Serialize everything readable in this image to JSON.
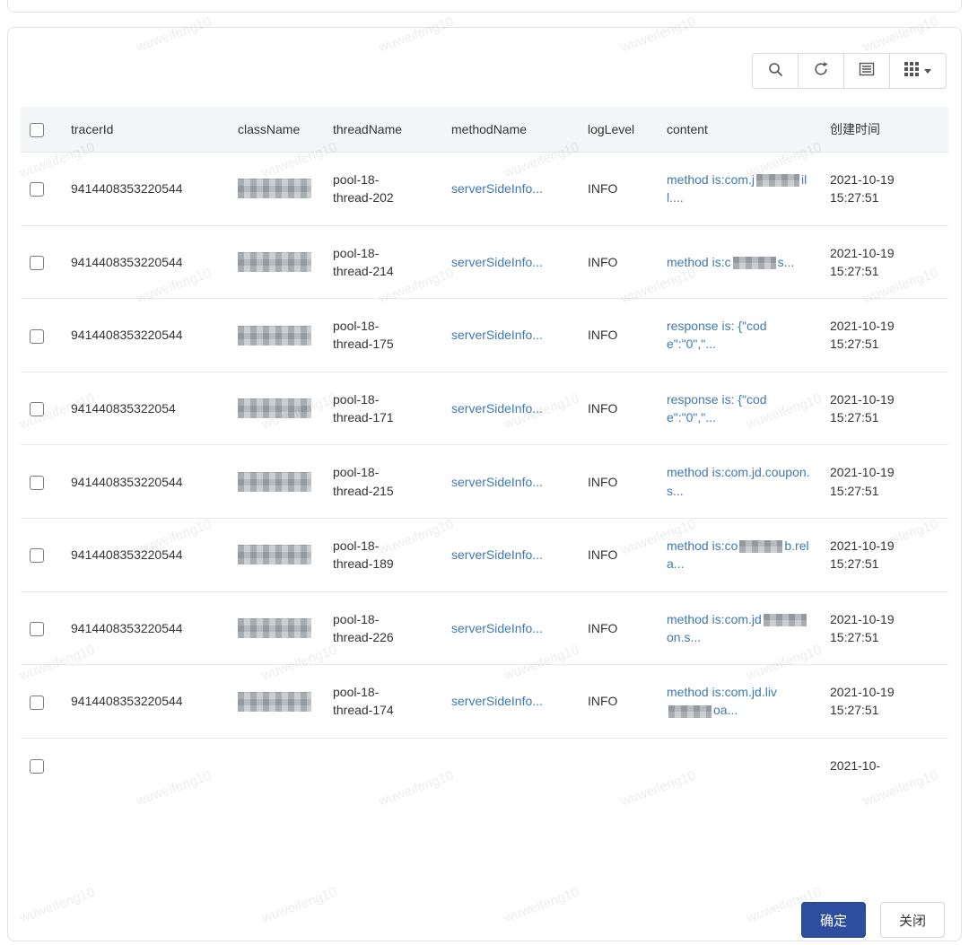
{
  "watermark": {
    "text": "wuweifeng10"
  },
  "toolbar": {
    "buttons": {
      "search": "search",
      "refresh": "refresh",
      "toggle_view": "toggle-view",
      "columns": "columns"
    }
  },
  "table": {
    "headers": {
      "tracerId": "tracerId",
      "className": "className",
      "threadName": "threadName",
      "methodName": "methodName",
      "logLevel": "logLevel",
      "content": "content",
      "time": "创建时间"
    },
    "rows": [
      {
        "tracerId": "9414408353220544",
        "className_redacted": true,
        "threadName": "pool-18-thread-202",
        "methodName": "serverSideInfo...",
        "logLevel": "INFO",
        "content": "method is:com.j[[blur]]ill....",
        "time": "2021-10-19 15:27:51"
      },
      {
        "tracerId": "9414408353220544",
        "className_redacted": true,
        "threadName": "pool-18-thread-214",
        "methodName": "serverSideInfo...",
        "logLevel": "INFO",
        "content": "method is:c[[blur]]s...",
        "time": "2021-10-19 15:27:51"
      },
      {
        "tracerId": "9414408353220544",
        "className_redacted": true,
        "threadName": "pool-18-thread-175",
        "methodName": "serverSideInfo...",
        "logLevel": "INFO",
        "content": "response is: {\"code\":\"0\",\"...",
        "time": "2021-10-19 15:27:51"
      },
      {
        "tracerId": "941440835322054",
        "className_redacted": true,
        "threadName": "pool-18-thread-171",
        "methodName": "serverSideInfo...",
        "logLevel": "INFO",
        "content": "response is: {\"code\":\"0\",\"...",
        "time": "2021-10-19 15:27:51"
      },
      {
        "tracerId": "9414408353220544",
        "className_redacted": true,
        "threadName": "pool-18-thread-215",
        "methodName": "serverSideInfo...",
        "logLevel": "INFO",
        "content": "method is:com.jd.coupon.s...",
        "time": "2021-10-19 15:27:51"
      },
      {
        "tracerId": "9414408353220544",
        "className_redacted": true,
        "threadName": "pool-18-thread-189",
        "methodName": "serverSideInfo...",
        "logLevel": "INFO",
        "content": "method is:co[[blur]]b.rela...",
        "time": "2021-10-19 15:27:51"
      },
      {
        "tracerId": "9414408353220544",
        "className_redacted": true,
        "threadName": "pool-18-thread-226",
        "methodName": "serverSideInfo...",
        "logLevel": "INFO",
        "content": "method is:com.jd[[blur]]on.s...",
        "time": "2021-10-19 15:27:51"
      },
      {
        "tracerId": "9414408353220544",
        "className_redacted": true,
        "threadName": "pool-18-thread-174",
        "methodName": "serverSideInfo...",
        "logLevel": "INFO",
        "content": "method is:com.jd.liv[[blur]]oa...",
        "time": "2021-10-19 15:27:51"
      }
    ],
    "partial_row_time": "2021-10-"
  },
  "footer": {
    "confirm_label": "确定",
    "close_label": "关闭"
  }
}
